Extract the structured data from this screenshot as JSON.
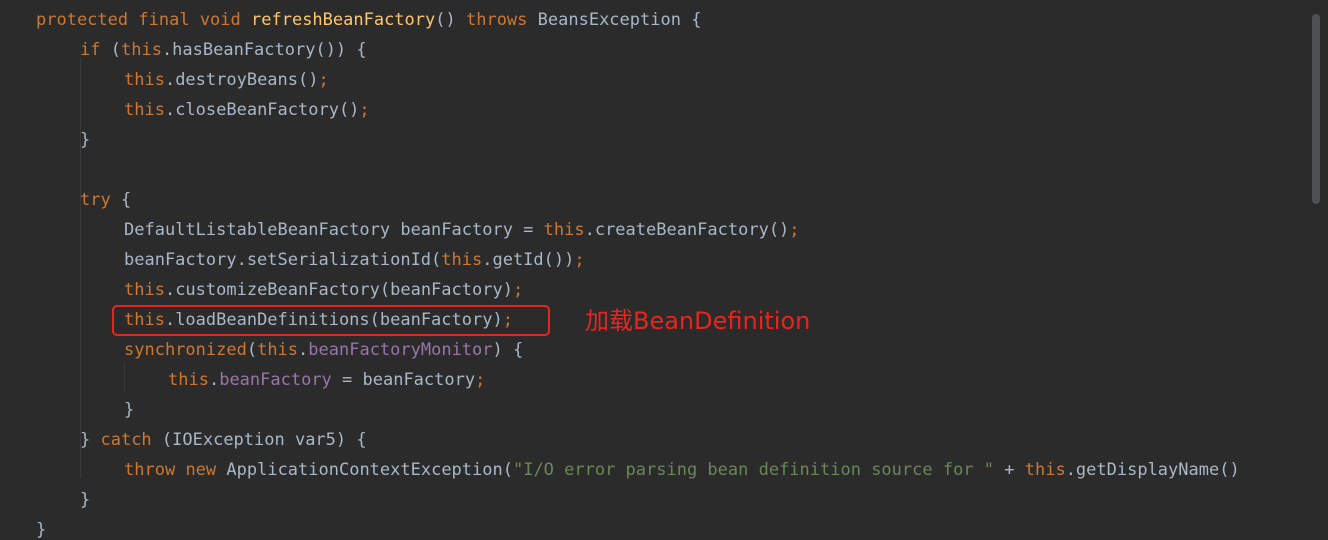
{
  "code": {
    "line1": {
      "kw1": "protected",
      "kw2": "final",
      "kw3": "void",
      "fn": "refreshBeanFactory",
      "paren": "()",
      "kw4": "throws",
      "type": "BeansException",
      "brace": "{"
    },
    "line2": {
      "kw": "if",
      "open": "(",
      "this": "this",
      "rest": ".hasBeanFactory()) {"
    },
    "line3": {
      "this": "this",
      "rest": ".destroyBeans()",
      "semi": ";"
    },
    "line4": {
      "this": "this",
      "rest": ".closeBeanFactory()",
      "semi": ";"
    },
    "line5": {
      "text": "}"
    },
    "line7": {
      "kw": "try",
      "rest": " {"
    },
    "line8": {
      "pre": "DefaultListableBeanFactory beanFactory = ",
      "this": "this",
      "rest": ".createBeanFactory()",
      "semi": ";"
    },
    "line9": {
      "pre": "beanFactory.setSerializationId(",
      "this": "this",
      "rest": ".getId())",
      "semi": ";"
    },
    "line10": {
      "this": "this",
      "rest": ".customizeBeanFactory(beanFactory)",
      "semi": ";"
    },
    "line11": {
      "this": "this",
      "rest": ".loadBeanDefinitions(beanFactory)",
      "semi": ";"
    },
    "line12": {
      "kw": "synchronized",
      "open": "(",
      "this": "this",
      "dot": ".",
      "field": "beanFactoryMonitor",
      "rest": ") {"
    },
    "line13": {
      "this": "this",
      "dot": ".",
      "field": "beanFactory",
      "rest": " = beanFactory",
      "semi": ";"
    },
    "line14": {
      "text": "}"
    },
    "line15": {
      "close": "} ",
      "kw": "catch",
      "rest": " (IOException var5) {"
    },
    "line16": {
      "kw1": "throw",
      "kw2": "new",
      "pre": " ApplicationContextException(",
      "str": "\"I/O error parsing bean definition source for \"",
      "plus": " + ",
      "this": "this",
      "rest": ".getDisplayName()"
    },
    "line17": {
      "text": "}"
    },
    "line18": {
      "text": "}"
    }
  },
  "annotation": {
    "text": "加载BeanDefinition"
  },
  "colors": {
    "background": "#2b2b2b",
    "keyword": "#cc7832",
    "method": "#ffc66d",
    "field": "#9876aa",
    "string": "#6a8759",
    "text": "#a9b7c6",
    "annotation": "#e8251d"
  }
}
